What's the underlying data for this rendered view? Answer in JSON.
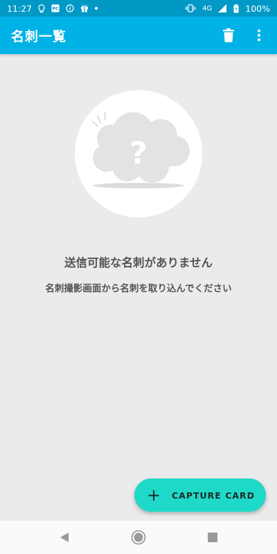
{
  "status_bar": {
    "time": "11:27",
    "network": "4G",
    "battery": "100%",
    "icons": [
      "lightbulb-icon",
      "pc-icon",
      "info-icon",
      "gift-icon",
      "dot-icon",
      "vibrate-icon",
      "signal-icon",
      "battery-icon"
    ]
  },
  "app_bar": {
    "title": "名刺一覧",
    "actions": [
      "delete-icon",
      "more-vert-icon"
    ],
    "color": "#00b2e5"
  },
  "empty_state": {
    "title": "送信可能な名刺がありません",
    "subtitle": "名刺撮影画面から名刺を取り込んでください",
    "illustration": "question-cloud-icon"
  },
  "fab": {
    "icon": "plus-icon",
    "label": "CAPTURE CARD",
    "color": "#1ed9c7"
  },
  "nav_bar": {
    "buttons": [
      "back-icon",
      "home-icon",
      "recents-icon"
    ]
  }
}
